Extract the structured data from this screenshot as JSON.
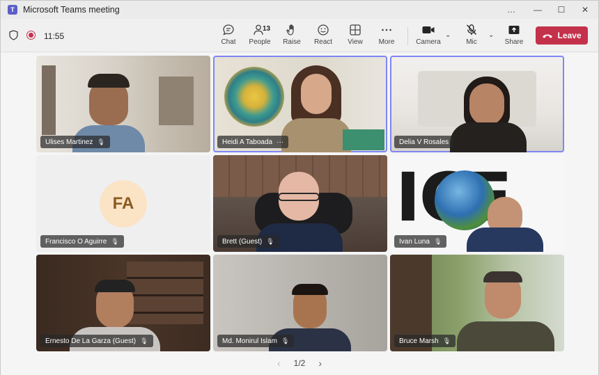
{
  "window": {
    "title": "Microsoft Teams meeting",
    "logo_letter": "T",
    "controls": [
      "…",
      "—",
      "☐",
      "✕"
    ]
  },
  "toolbar": {
    "timer": "11:55",
    "people_count": "13",
    "buttons": {
      "chat": "Chat",
      "people": "People",
      "raise": "Raise",
      "react": "React",
      "view": "View",
      "more": "More",
      "camera": "Camera",
      "mic": "Mic",
      "share": "Share",
      "leave": "Leave"
    },
    "colors": {
      "leave": "#c4314b",
      "active_border": "#7f85f5"
    }
  },
  "participants": [
    {
      "name": "Ulises Martinez",
      "active": false
    },
    {
      "name": "Heidi A Taboada",
      "active": true,
      "more": "···"
    },
    {
      "name": "Delia V Rosales",
      "active": true
    },
    {
      "name": "Francisco O Aguirre",
      "active": false,
      "initials": "FA"
    },
    {
      "name": "Brett (Guest)",
      "active": false
    },
    {
      "name": "Ivan Luna",
      "active": false,
      "bg_text": "ICE"
    },
    {
      "name": "Ernesto De La Garza (Guest)",
      "active": false
    },
    {
      "name": "Md. Monirul Islam",
      "active": false
    },
    {
      "name": "Bruce Marsh",
      "active": false
    }
  ],
  "pager": {
    "label": "1/2",
    "prev": "‹",
    "next": "›"
  }
}
